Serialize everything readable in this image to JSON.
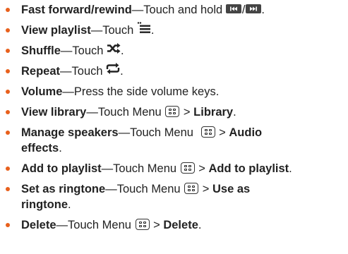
{
  "colors": {
    "bullet": "#e8601c",
    "text": "#222222"
  },
  "items": [
    {
      "title": "Fast forward/rewind",
      "sep": "—",
      "text": "Touch and hold",
      "icons": [
        "rewind-icon",
        "fast-forward-icon"
      ],
      "slash": "/",
      "end": "."
    },
    {
      "title": "View playlist",
      "sep": "—",
      "text": "Touch",
      "icon": "playlist-icon",
      "end": "."
    },
    {
      "title": "Shuffle",
      "sep": "—",
      "text": "Touch",
      "icon": "shuffle-icon",
      "end": "."
    },
    {
      "title": "Repeat",
      "sep": "—",
      "text": "Touch",
      "icon": "repeat-icon",
      "end": "."
    },
    {
      "title": "Volume",
      "sep": "—",
      "text": "Press the side volume keys."
    },
    {
      "title": "View library",
      "sep": "—",
      "text": "Touch Menu",
      "icon": "menu-key-icon",
      "gt": ">",
      "bold_end": "Library",
      "end": "."
    },
    {
      "title": "Manage speakers",
      "sep": "—",
      "text": "Touch Menu",
      "icon": "menu-key-icon",
      "gt": ">",
      "bold_end": "Audio",
      "bold_end_line2": "effects",
      "end": "."
    },
    {
      "title": "Add to playlist",
      "sep": "—",
      "text": "Touch Menu",
      "icon": "menu-key-icon",
      "gt": ">",
      "bold_end": "Add to playlist",
      "end": "."
    },
    {
      "title": "Set as ringtone",
      "sep": "—",
      "text": "Touch Menu",
      "icon": "menu-key-icon",
      "gt": ">",
      "bold_end": "Use as",
      "bold_end_line2": "ringtone",
      "end": "."
    },
    {
      "title": "Delete",
      "sep": "—",
      "text": "Touch Menu",
      "icon": "menu-key-icon",
      "gt": ">",
      "bold_end": "Delete",
      "end": "."
    }
  ]
}
